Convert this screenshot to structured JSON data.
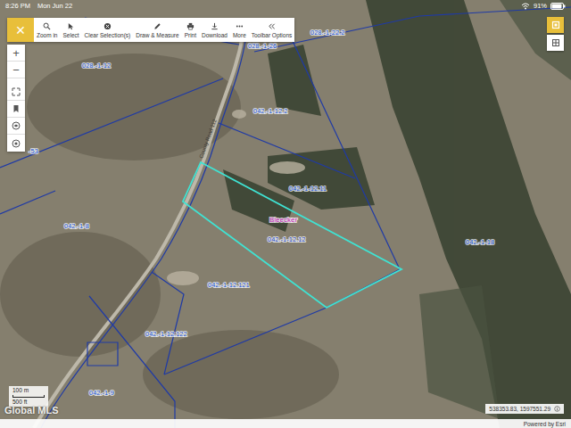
{
  "status_bar": {
    "time": "8:26 PM",
    "date": "Mon Jun 22",
    "battery": "91%",
    "battery_level": 0.91
  },
  "toolbar": {
    "close": "×",
    "items": [
      {
        "label": "Zoom in",
        "kind": "zoom"
      },
      {
        "label": "Select",
        "kind": "select"
      },
      {
        "label": "Clear Selection(s)",
        "kind": "clear"
      },
      {
        "label": "Draw & Measure",
        "kind": "draw"
      },
      {
        "label": "Print",
        "kind": "print"
      },
      {
        "label": "Download",
        "kind": "download"
      },
      {
        "label": "More",
        "kind": "more"
      },
      {
        "label": "Toolbar Options",
        "kind": "options"
      }
    ]
  },
  "zoom_buttons": [
    "+",
    "−"
  ],
  "map": {
    "road": "County Road 112",
    "municipality": "Bleecker",
    "parcels": [
      {
        "label": "028.-1-12",
        "selected": false
      },
      {
        "label": "028.-1-26",
        "selected": false
      },
      {
        "label": "028.-1-22.2",
        "selected": false
      },
      {
        "label": "042.-1-12.2",
        "selected": false
      },
      {
        "label": "042.-1-12.11",
        "selected": false
      },
      {
        "label": "042.-1-12.12",
        "selected": true
      },
      {
        "label": "042.-1-18",
        "selected": false
      },
      {
        "label": "042.-1-8",
        "selected": false
      },
      {
        "label": "042.-1-12.121",
        "selected": false
      },
      {
        "label": "042.-1-12.122",
        "selected": false
      },
      {
        "label": "042.-1-9",
        "selected": false
      },
      {
        "label": "-53",
        "selected": false
      }
    ]
  },
  "scale": {
    "metric": "100 m",
    "imperial": "500 ft"
  },
  "coordinates": "538353.83, 1597551.29",
  "attribution": "Powered by Esri",
  "watermark": "Global MLS"
}
